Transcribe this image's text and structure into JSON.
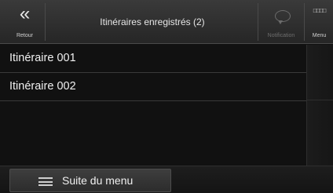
{
  "header": {
    "back_glyph": "«",
    "back_label": "Retour",
    "title": "Itinéraires enregistrés (2)",
    "notification_label": "Notification",
    "menu_glyph": "□□□□",
    "menu_label": "Menu"
  },
  "routes": [
    {
      "name": "Itinéraire 001"
    },
    {
      "name": "Itinéraire 002"
    }
  ],
  "footer": {
    "more_menu_label": "Suite du menu"
  },
  "icons": {
    "back": "double-chevron-left-icon",
    "notification": "speech-bubble-icon",
    "menu": "menu-grid-icon",
    "more_menu": "list-lines-icon"
  },
  "colors": {
    "header_bg": "#2f2f2f",
    "list_bg": "#111111",
    "text": "#f0f0f0",
    "disabled_text": "#6e6e6e"
  }
}
